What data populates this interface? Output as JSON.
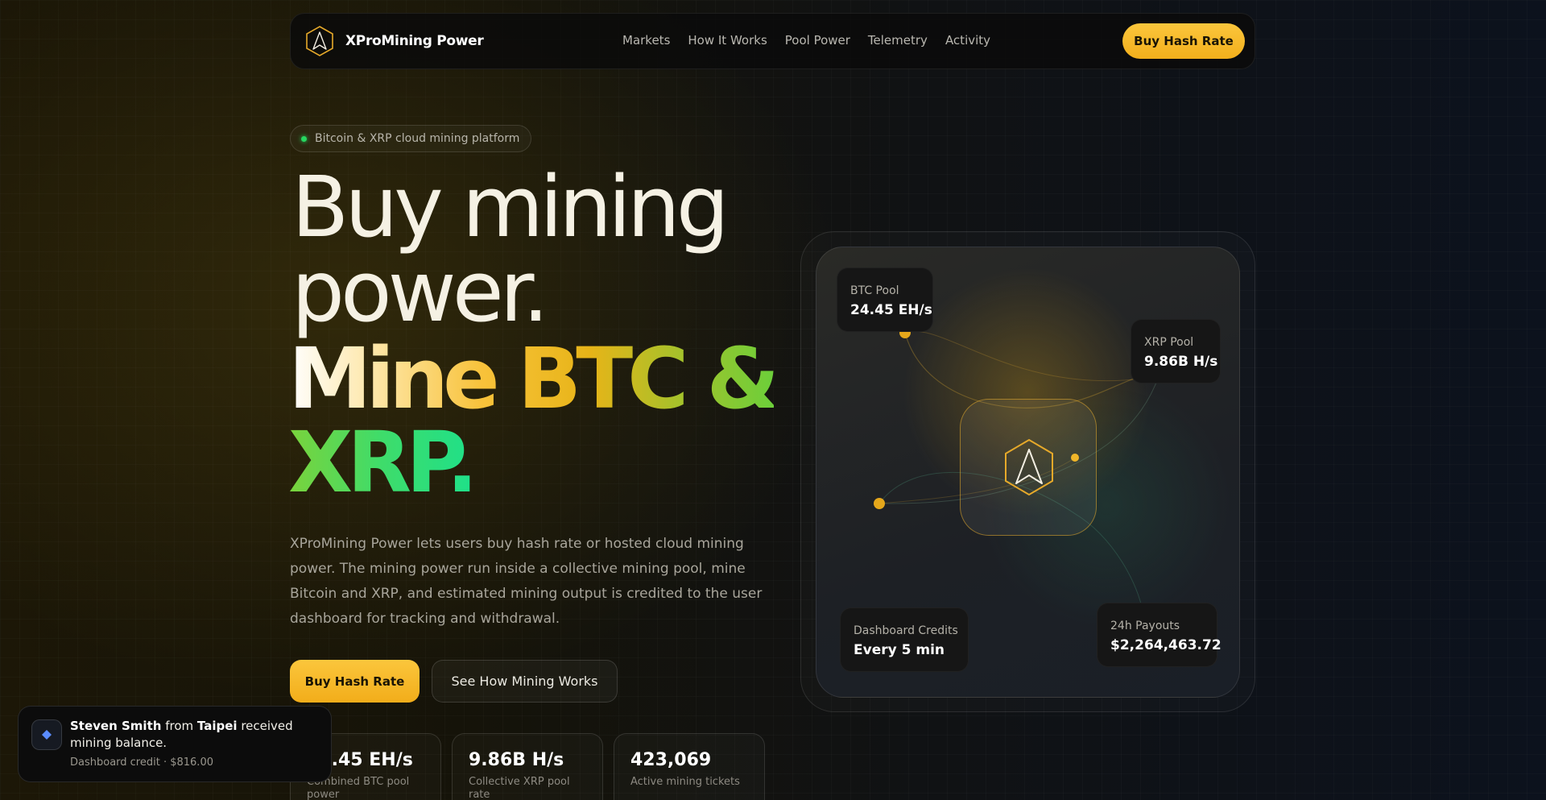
{
  "nav": {
    "brand": "XProMining Power",
    "links": [
      "Markets",
      "How It Works",
      "Pool Power",
      "Telemetry",
      "Activity"
    ],
    "cta": "Buy Hash Rate"
  },
  "hero": {
    "badge": "Bitcoin & XRP cloud mining platform",
    "title_line1": "Buy mining",
    "title_line2": "power.",
    "accent_line1": "Mine BTC &",
    "accent_line2": "XRP.",
    "description": "XProMining Power lets users buy hash rate or hosted cloud mining power. The mining power run inside a collective mining pool, mine Bitcoin and XRP, and estimated mining output is credited to the user dashboard for tracking and withdrawal.",
    "primary_button": "Buy Hash Rate",
    "secondary_button": "See How Mining Works"
  },
  "stats": [
    {
      "value": "24.45 EH/s",
      "label": "Combined BTC pool power"
    },
    {
      "value": "9.86B H/s",
      "label": "Collective XRP pool rate"
    },
    {
      "value": "423,069",
      "label": "Active mining tickets"
    }
  ],
  "visual": {
    "btc_pool": {
      "label": "BTC Pool",
      "value": "24.45 EH/s"
    },
    "xrp_pool": {
      "label": "XRP Pool",
      "value": "9.86B H/s"
    },
    "dashboard": {
      "label": "Dashboard Credits",
      "value": "Every 5 min"
    },
    "payouts": {
      "label": "24h Payouts",
      "value": "$2,264,463.72"
    }
  },
  "toast": {
    "name": "Steven Smith",
    "from_word": "from",
    "city": "Taipei",
    "message": "received mining balance.",
    "sub": "Dashboard credit · $816.00"
  },
  "colors": {
    "accent": "#f8c23a",
    "green": "#26d760",
    "background": "#141309"
  }
}
